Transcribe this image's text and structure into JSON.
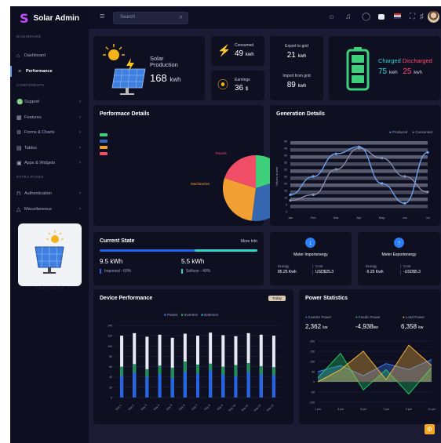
{
  "app": {
    "logo_mark": "S",
    "title": "Solar Admin"
  },
  "topbar": {
    "search_placeholder": "Search"
  },
  "sidebar": {
    "section_dashboard": "DASHBOARD",
    "items_top": [
      {
        "label": "Dashboard",
        "icon": "home-icon"
      },
      {
        "label": "Performance",
        "icon": "menu-icon",
        "active": true
      }
    ],
    "section_components": "COMPONENTS",
    "items_components": [
      {
        "label": "Support",
        "icon": "headset-icon"
      },
      {
        "label": "Features",
        "icon": "grid-icon"
      },
      {
        "label": "Forms & Charts",
        "icon": "clipboard-icon"
      },
      {
        "label": "Tables",
        "icon": "table-icon"
      },
      {
        "label": "Apps & Widgets",
        "icon": "widgets-icon"
      }
    ],
    "section_extra": "EXTRA PAGES",
    "items_extra": [
      {
        "label": "Authentication",
        "icon": "lock-icon"
      },
      {
        "label": "Miscellaneous",
        "icon": "warning-icon"
      }
    ],
    "promo_label": "Solar Admin"
  },
  "solar_production": {
    "label_line1": "Solar",
    "label_line2": "Production",
    "value": "168",
    "unit": "kwh"
  },
  "consumed": {
    "label": "Consumed",
    "value": "49",
    "unit": "kwh"
  },
  "earnings": {
    "label": "Earnings",
    "value": "36",
    "unit": "$"
  },
  "export_grid": {
    "label": "Export to grid",
    "value": "21",
    "unit": "kwh"
  },
  "import_grid": {
    "label": "Import from grid",
    "value": "89",
    "unit": "kwh"
  },
  "battery": {
    "charged_label": "Charged",
    "discharged_label": "Discharged",
    "charged_value": "75",
    "charged_unit": "kwh",
    "discharged_value": "25",
    "discharged_unit": "kwh",
    "charged_color": "#30d5c8",
    "discharged_color": "#ff4d6d"
  },
  "performance_details": {
    "title": "Performace Details",
    "legend": [
      {
        "name": "",
        "color": "#3ecf7a"
      },
      {
        "name": "",
        "color": "#3566b0"
      },
      {
        "name": "",
        "color": "#f2a033"
      },
      {
        "name": "",
        "color": "#f04e67"
      }
    ],
    "pie_labels": {
      "panels": "Panels",
      "machinery": "Machineries"
    }
  },
  "generation_details": {
    "title": "Generation Details",
    "legend": [
      {
        "name": "Produced",
        "color": "#6ca6f5"
      },
      {
        "name": "Consumed",
        "color": "#8a8fb0"
      }
    ]
  },
  "current_state": {
    "title": "Current State",
    "more_link": "More Info",
    "left_value": "9.5 kWh",
    "right_value": "5.5 kWh",
    "left_note": "Imported - 60%",
    "right_note": "Selfuse - 40%"
  },
  "meter_import": {
    "title": "Meter Importenergy",
    "energy_label": "Energy",
    "energy_value": "85.25 Kwh",
    "cost_label": "Cost",
    "cost_value": "USD$25.3"
  },
  "meter_export": {
    "title": "Meter Exportenergy",
    "energy_label": "Energy",
    "energy_value": "-5.25 Kwh",
    "cost_label": "Cost",
    "cost_value": "-USD$5.3"
  },
  "device_performance": {
    "title": "Device Performance",
    "badge": "Today",
    "legend": [
      {
        "name": "Panels",
        "color": "#3b82f6"
      },
      {
        "name": "Inverters",
        "color": "#22c55e"
      },
      {
        "name": "Batteries",
        "color": "#22b8cf"
      }
    ]
  },
  "power_statistics": {
    "title": "Power Statistics",
    "stats": [
      {
        "label": "Inverter Power",
        "value": "2,362",
        "unit": "kw",
        "color": "#3b82f6"
      },
      {
        "label": "Feedin Power",
        "value": "-4,938",
        "unit": "kw",
        "color": "#22c55e"
      },
      {
        "label": "Load Power",
        "value": "6,358",
        "unit": "kw",
        "color": "#f5b33a"
      }
    ]
  },
  "chart_data": [
    {
      "type": "pie",
      "values": [
        20,
        32,
        28,
        20
      ],
      "colors": [
        "#3ecf7a",
        "#3566b0",
        "#f2a033",
        "#f04e67"
      ]
    },
    {
      "type": "line",
      "categories": [
        "Jan",
        "Feb",
        "Mar",
        "Apr",
        "May",
        "Jun",
        "Jul"
      ],
      "ylim": [
        0,
        50
      ],
      "ylabel": "Values in kwh",
      "series": [
        {
          "name": "Produced",
          "values": [
            12,
            25,
            41,
            46,
            20,
            6,
            42
          ]
        },
        {
          "name": "Consumed",
          "values": [
            8,
            12,
            30,
            45,
            38,
            25,
            14
          ]
        }
      ]
    },
    {
      "type": "bar",
      "categories": [
        "Day 1",
        "Day 2",
        "Day 3",
        "Day 4",
        "Day 5",
        "Day 6",
        "Day 7",
        "Day 8",
        "Day 9",
        "Day 10",
        "Day 11",
        "Day 12",
        "Day 13"
      ],
      "ylim": [
        0,
        140
      ],
      "series": [
        {
          "name": "Panels",
          "values": [
            120,
            125,
            118,
            122,
            116,
            124,
            120,
            126,
            121,
            119,
            125,
            122,
            120
          ]
        },
        {
          "name": "Inverters",
          "values": [
            60,
            65,
            55,
            62,
            58,
            70,
            64,
            66,
            60,
            63,
            67,
            61,
            59
          ]
        },
        {
          "name": "Batteries",
          "values": [
            42,
            48,
            40,
            45,
            38,
            50,
            46,
            52,
            44,
            41,
            49,
            45,
            43
          ]
        }
      ]
    },
    {
      "type": "area",
      "categories": [
        "1 pm",
        "3 pm",
        "5 pm",
        "7 pm",
        "9 pm",
        "11 pm"
      ],
      "ylim": [
        -100,
        200
      ],
      "series": [
        {
          "name": "Inverter Power",
          "values": [
            50,
            80,
            30,
            90,
            60,
            110
          ]
        },
        {
          "name": "Feedin Power",
          "values": [
            20,
            140,
            -40,
            60,
            -60,
            70
          ]
        },
        {
          "name": "Load Power",
          "values": [
            0,
            60,
            150,
            10,
            180,
            80
          ]
        }
      ]
    }
  ]
}
